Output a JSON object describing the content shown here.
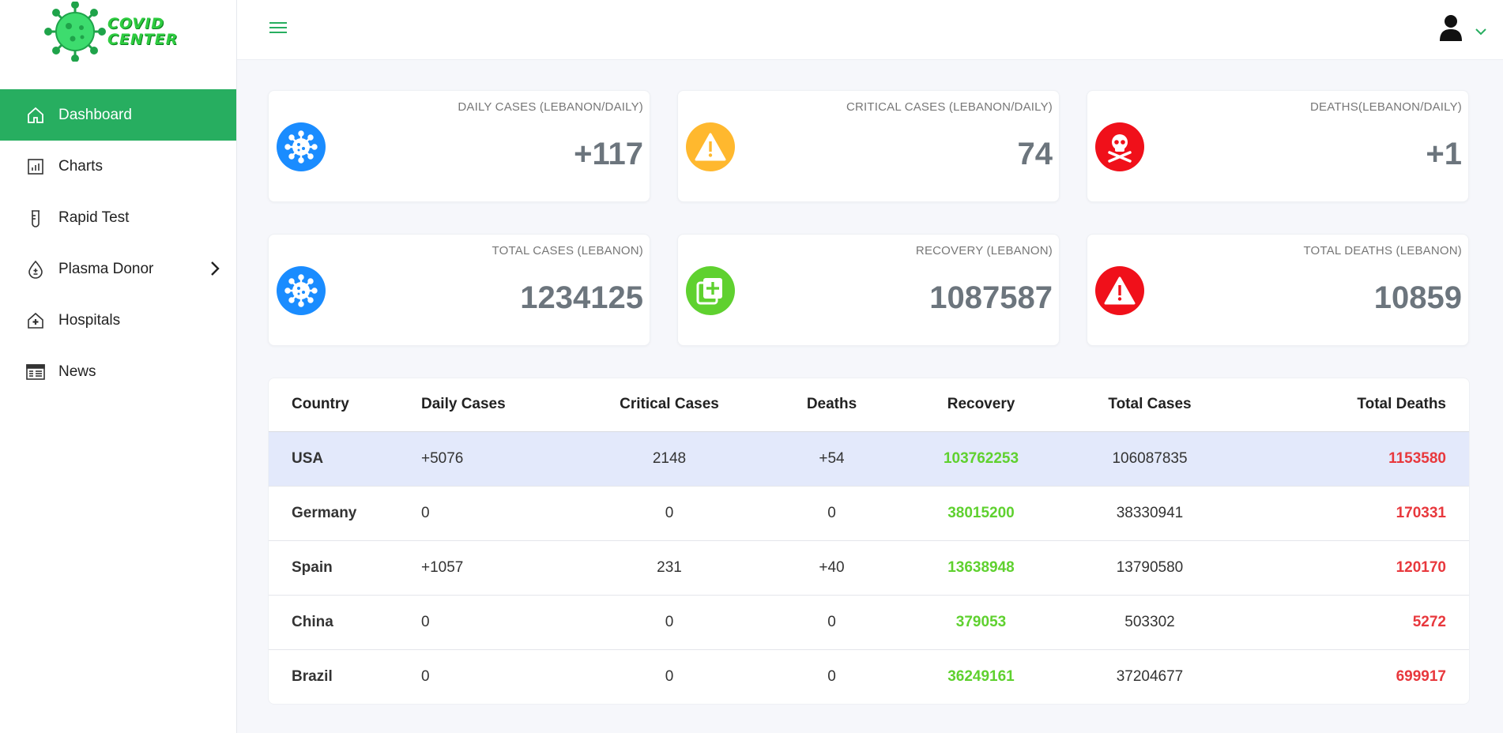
{
  "brand": {
    "line1": "COVID",
    "line2": "CENTER",
    "color": "#2ecc40"
  },
  "sidebar": {
    "items": [
      {
        "label": "Dashboard",
        "icon": "home-icon",
        "active": true
      },
      {
        "label": "Charts",
        "icon": "chart-icon"
      },
      {
        "label": "Rapid Test",
        "icon": "test-tube-icon"
      },
      {
        "label": "Plasma Donor",
        "icon": "blood-drop-icon",
        "has_submenu": true
      },
      {
        "label": "Hospitals",
        "icon": "hospital-icon"
      },
      {
        "label": "News",
        "icon": "newspaper-icon"
      }
    ]
  },
  "header": {
    "menu_icon": "hamburger-icon",
    "user_icon": "user-icon",
    "dropdown_icon": "chevron-down-icon"
  },
  "cards": [
    {
      "label": "DAILY CASES (LEBANON/DAILY)",
      "value": "+117",
      "icon": "virus-icon",
      "color": "#1a8cff"
    },
    {
      "label": "CRITICAL CASES (LEBANON/DAILY)",
      "value": "74",
      "icon": "warning-icon",
      "color": "#ffb82e"
    },
    {
      "label": "DEATHS(LEBANON/DAILY)",
      "value": "+1",
      "icon": "skull-icon",
      "color": "#f0101a"
    },
    {
      "label": "TOTAL CASES (LEBANON)",
      "value": "1234125",
      "icon": "virus-icon",
      "color": "#1a8cff"
    },
    {
      "label": "RECOVERY (LEBANON)",
      "value": "1087587",
      "icon": "medical-plus-icon",
      "color": "#5fd12f"
    },
    {
      "label": "TOTAL DEATHS (LEBANON)",
      "value": "10859",
      "icon": "alert-icon",
      "color": "#f0101a"
    }
  ],
  "table": {
    "headers": [
      "Country",
      "Daily Cases",
      "Critical Cases",
      "Deaths",
      "Recovery",
      "Total Cases",
      "Total Deaths"
    ],
    "rows": [
      [
        "USA",
        "+5076",
        "2148",
        "+54",
        "103762253",
        "106087835",
        "1153580"
      ],
      [
        "Germany",
        "0",
        "0",
        "0",
        "38015200",
        "38330941",
        "170331"
      ],
      [
        "Spain",
        "+1057",
        "231",
        "+40",
        "13638948",
        "13790580",
        "120170"
      ],
      [
        "China",
        "0",
        "0",
        "0",
        "379053",
        "503302",
        "5272"
      ],
      [
        "Brazil",
        "0",
        "0",
        "0",
        "36249161",
        "37204677",
        "699917"
      ]
    ]
  }
}
